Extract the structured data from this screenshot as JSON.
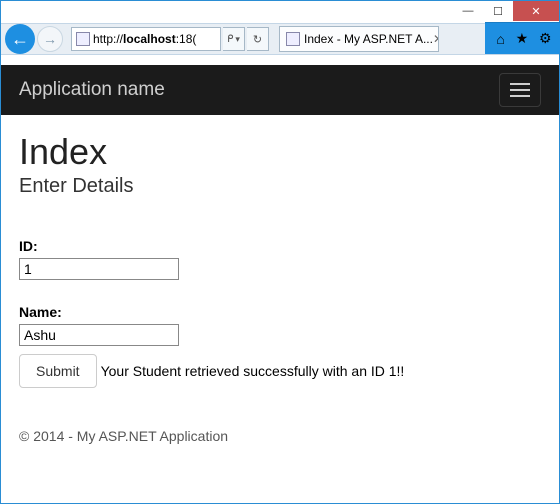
{
  "window": {
    "minimize_glyph": "—",
    "maximize_glyph": "☐",
    "close_glyph": "✕"
  },
  "browser": {
    "back_glyph": "←",
    "fwd_glyph": "→",
    "url_prefix": "http://",
    "url_host": "localhost",
    "url_rest": ":18(",
    "search_glyph": "🔍",
    "dropdown_glyph": "▾",
    "refresh_glyph": "↻",
    "tab_title": "Index - My ASP.NET A...",
    "tab_close_glyph": "✕",
    "home_glyph": "⌂",
    "star_glyph": "★",
    "gear_glyph": "⚙"
  },
  "navbar": {
    "brand": "Application name"
  },
  "page": {
    "heading": "Index",
    "subheading": "Enter Details",
    "id_label": "ID:",
    "id_value": "1",
    "name_label": "Name:",
    "name_value": "Ashu",
    "submit_label": "Submit",
    "result_message": "Your Student retrieved successfully with an ID 1!!",
    "footer": "© 2014 - My ASP.NET Application"
  }
}
